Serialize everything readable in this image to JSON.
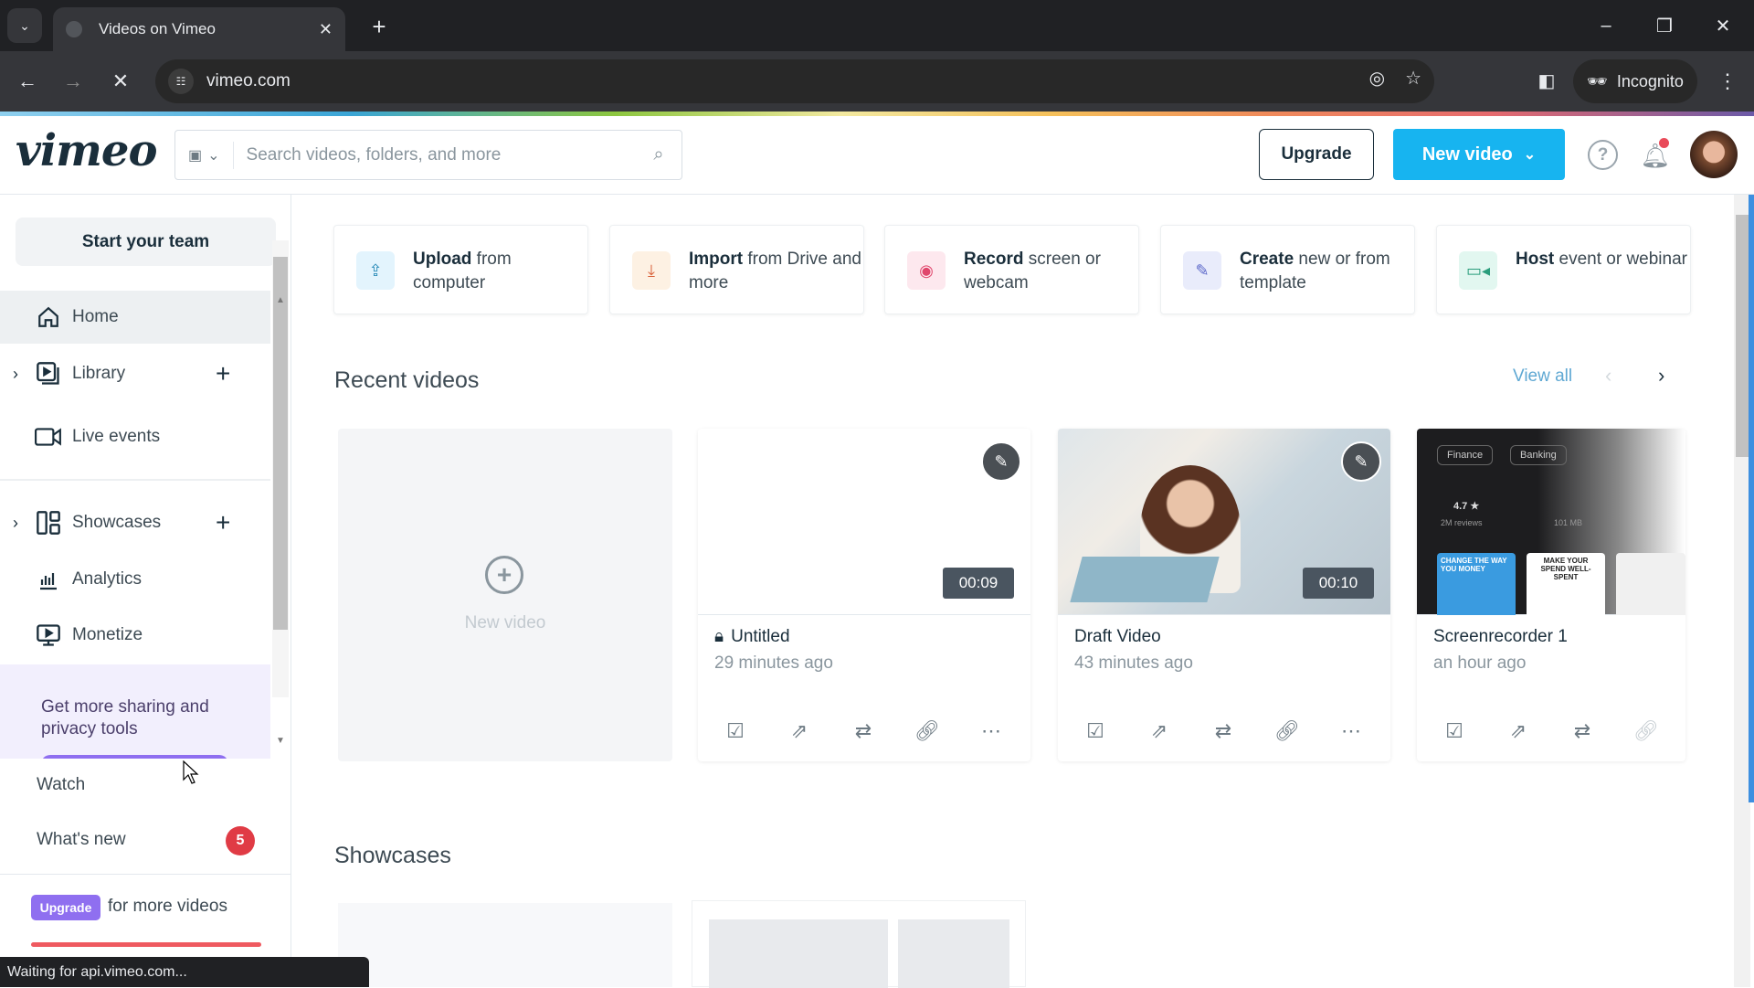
{
  "browser": {
    "tab_title": "Videos on Vimeo",
    "url": "vimeo.com",
    "incognito_label": "Incognito",
    "status_text": "Waiting for api.vimeo.com..."
  },
  "header": {
    "logo": "vimeo",
    "search_placeholder": "Search videos, folders, and more",
    "upgrade_label": "Upgrade",
    "new_video_label": "New video",
    "notification_dot": true,
    "brand_color": "#17b4f0"
  },
  "sidebar": {
    "start_team": "Start your team",
    "items": [
      {
        "label": "Home",
        "icon": "home-icon",
        "active": true
      },
      {
        "label": "Library",
        "icon": "library-icon",
        "expandable": true,
        "addable": true
      },
      {
        "label": "Live events",
        "icon": "camera-icon"
      },
      {
        "label": "Showcases",
        "icon": "showcases-icon",
        "expandable": true,
        "addable": true
      },
      {
        "label": "Analytics",
        "icon": "analytics-icon"
      },
      {
        "label": "Monetize",
        "icon": "monetize-icon"
      }
    ],
    "promo_text": "Get more sharing and privacy tools",
    "links": [
      {
        "label": "Watch"
      },
      {
        "label": "What's new",
        "badge": "5"
      }
    ],
    "upgrade_chip": "Upgrade",
    "upgrade_text": "for more videos"
  },
  "actions": [
    {
      "bold": "Upload",
      "rest": " from computer",
      "icon": "upload-cloud-icon",
      "bg": "#e3f4fd",
      "fg": "#2a8bb8"
    },
    {
      "bold": "Import",
      "rest": " from Drive and more",
      "icon": "download-icon",
      "bg": "#fdf1e3",
      "fg": "#d8623a"
    },
    {
      "bold": "Record",
      "rest": " screen or webcam",
      "icon": "record-icon",
      "bg": "#fde8ee",
      "fg": "#e0466c"
    },
    {
      "bold": "Create",
      "rest": " new or from template",
      "icon": "create-edit-icon",
      "bg": "#e9ecfb",
      "fg": "#5b67c9"
    },
    {
      "bold": "Host",
      "rest": " event or webinar",
      "icon": "video-camera-icon",
      "bg": "#e2f7f0",
      "fg": "#2a9d7c"
    }
  ],
  "recent": {
    "heading": "Recent videos",
    "view_all": "View all",
    "new_video_label": "New video",
    "videos": [
      {
        "title": "Untitled",
        "time": "29 minutes ago",
        "duration": "00:09",
        "private": true
      },
      {
        "title": "Draft Video",
        "time": "43 minutes ago",
        "duration": "00:10",
        "private": false
      },
      {
        "title": "Screenrecorder 1",
        "time": "an hour ago",
        "duration": "",
        "private": false,
        "thumb_text": {
          "chip1": "Finance",
          "chip2": "Banking",
          "rating": "4.7 ★",
          "reviews": "2M reviews",
          "size": "101 MB",
          "card1": "CHANGE THE WAY YOU MONEY",
          "card2": "MAKE YOUR SPEND WELL-SPENT"
        }
      }
    ]
  },
  "showcases": {
    "heading": "Showcases"
  }
}
